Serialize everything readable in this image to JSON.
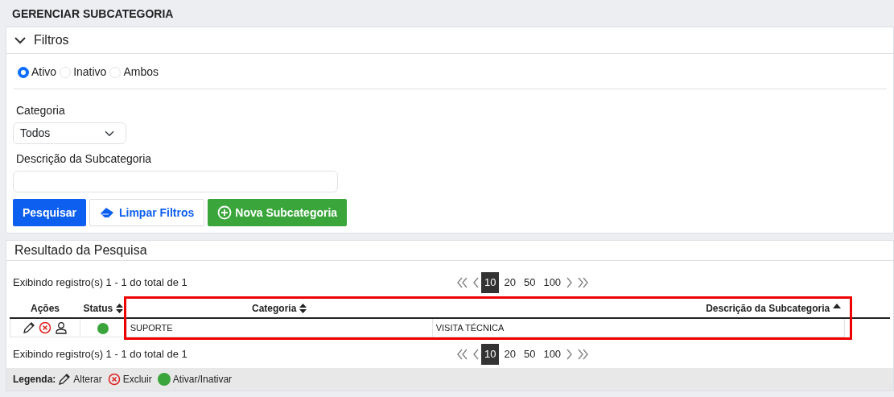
{
  "title": "GERENCIAR SUBCATEGORIA",
  "filters": {
    "title": "Filtros",
    "expanded": true,
    "status_options": [
      {
        "label": "Ativo",
        "selected": true
      },
      {
        "label": "Inativo",
        "selected": false
      },
      {
        "label": "Ambos",
        "selected": false
      }
    ],
    "category": {
      "label": "Categoria",
      "value": "Todos"
    },
    "description": {
      "label": "Descrição da Subcategoria"
    },
    "buttons": [
      {
        "kind": "search",
        "label": "Pesquisar"
      },
      {
        "kind": "clear",
        "label": "Limpar Filtros"
      },
      {
        "kind": "new",
        "label": "Nova Subcategoria"
      }
    ]
  },
  "results": {
    "title": "Resultado da Pesquisa",
    "summary_top": "Exibindo registro(s) 1 - 1 do total de 1",
    "page_sizes_top": [
      {
        "label": "10",
        "selected": true
      },
      {
        "label": "20",
        "selected": false
      },
      {
        "label": "50",
        "selected": false
      },
      {
        "label": "100",
        "selected": false
      }
    ],
    "columns": [
      {
        "label": "Ações",
        "sortable": false
      },
      {
        "label": "Status",
        "sortable": true,
        "sorted": false
      },
      {
        "label": "Categoria",
        "sortable": true,
        "sorted": false
      },
      {
        "label": "Descrição da Subcategoria",
        "sortable": true,
        "sorted": true
      }
    ],
    "rows": [
      {
        "active": true,
        "category": "SUPORTE",
        "description": "VISITA TÉCNICA"
      }
    ],
    "summary_bottom": "Exibindo registro(s) 1 - 1 do total de 1",
    "page_sizes_bottom": [
      {
        "label": "10",
        "selected": true
      },
      {
        "label": "20",
        "selected": false
      },
      {
        "label": "50",
        "selected": false
      },
      {
        "label": "100",
        "selected": false
      }
    ],
    "highlight": {
      "color": "#ee0000"
    }
  },
  "legend": {
    "title": "Legenda:",
    "items": [
      {
        "kind": "edit",
        "label": "Alterar"
      },
      {
        "kind": "delete",
        "label": "Excluir"
      },
      {
        "kind": "status",
        "label": "Ativar/Inativar"
      }
    ]
  }
}
